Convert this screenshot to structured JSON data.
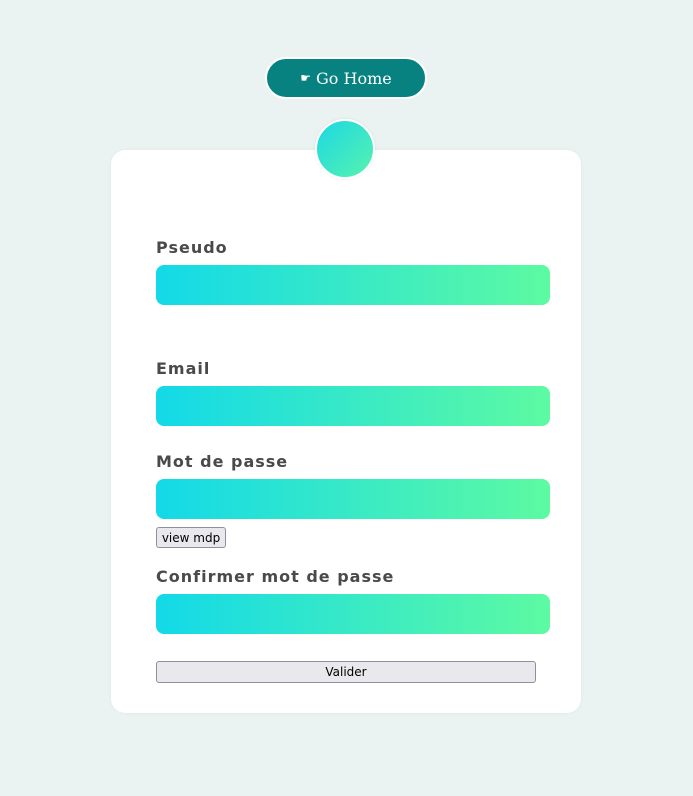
{
  "header": {
    "home_button": {
      "icon": "mortarboard-icon",
      "icon_glyph": "☛",
      "label": "Go Home"
    }
  },
  "form": {
    "fields": [
      {
        "label": "Pseudo",
        "value": ""
      },
      {
        "label": "Email",
        "value": ""
      },
      {
        "label": "Mot de passe",
        "value": ""
      },
      {
        "label": "Confirmer mot de passe",
        "value": ""
      }
    ],
    "view_password_label": "view mdp",
    "submit_label": "Valider"
  },
  "colors": {
    "page_background": "#eaf3f1",
    "home_button_background": "#078281",
    "gradient_start": "#13d9e8",
    "gradient_end": "#5dfaa2",
    "label_text": "#4a4a4a"
  }
}
